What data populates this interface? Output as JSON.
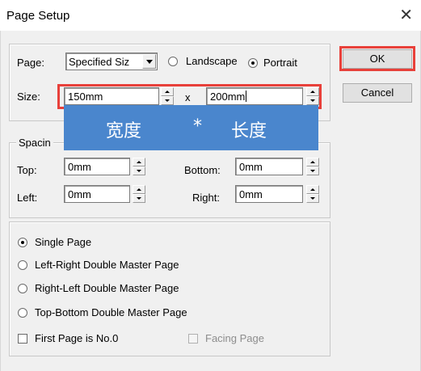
{
  "window": {
    "title": "Page Setup",
    "close_glyph": "✕"
  },
  "page": {
    "label": "Page:",
    "combo_value": "Specified Siz",
    "landscape_label": "Landscape",
    "portrait_label": "Portrait",
    "orientation_selected": "Portrait"
  },
  "size": {
    "label": "Size:",
    "width_value": "150mm",
    "separator": "x",
    "height_value": "200mm"
  },
  "spacing": {
    "legend": "Spacin",
    "top_label": "Top:",
    "top_value": "0mm",
    "bottom_label": "Bottom:",
    "bottom_value": "0mm",
    "left_label": "Left:",
    "left_value": "0mm",
    "right_label": "Right:",
    "right_value": "0mm"
  },
  "layout_options": {
    "single": "Single Page",
    "lr_double": "Left-Right Double Master Page",
    "rl_double": "Right-Left Double Master Page",
    "tb_double": "Top-Bottom Double Master Page",
    "selected": "Single Page",
    "first_page": "First Page is No.0",
    "facing_page": "Facing Page"
  },
  "buttons": {
    "ok": "OK",
    "cancel": "Cancel"
  },
  "annotation": {
    "width_text": "宽度",
    "star": "*",
    "height_text": "长度",
    "color": "#4a86cd"
  },
  "highlight_color": "#e8403a"
}
